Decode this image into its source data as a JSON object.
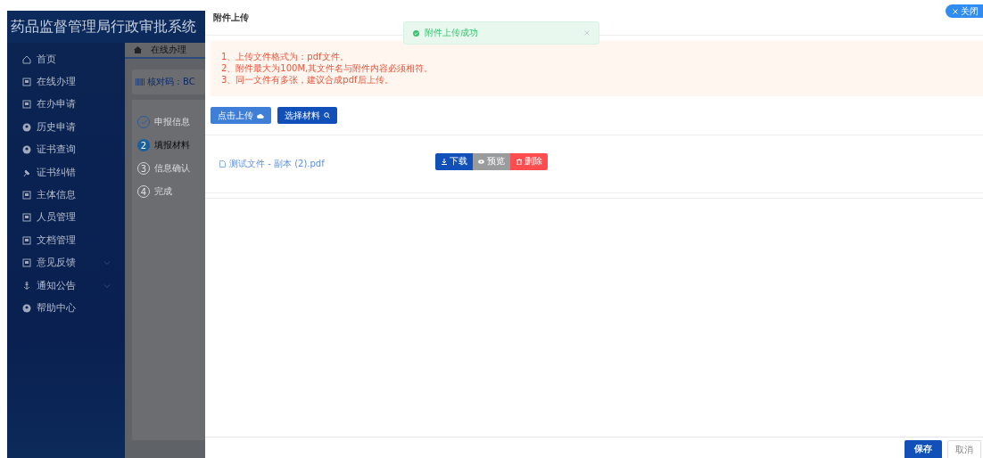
{
  "app": {
    "title": "药品监督管理局行政审批系统"
  },
  "sidebar": {
    "items": [
      {
        "label": "首页",
        "kind": "home",
        "expandable": false
      },
      {
        "label": "在线办理",
        "kind": "doc",
        "expandable": false
      },
      {
        "label": "在办申请",
        "kind": "doc",
        "expandable": false
      },
      {
        "label": "历史申请",
        "kind": "user",
        "expandable": false
      },
      {
        "label": "证书查询",
        "kind": "user",
        "expandable": false
      },
      {
        "label": "证书纠错",
        "kind": "pin",
        "expandable": false
      },
      {
        "label": "主体信息",
        "kind": "doc",
        "expandable": false
      },
      {
        "label": "人员管理",
        "kind": "doc",
        "expandable": false
      },
      {
        "label": "文档管理",
        "kind": "doc",
        "expandable": false
      },
      {
        "label": "意见反馈",
        "kind": "doc",
        "expandable": true
      },
      {
        "label": "通知公告",
        "kind": "anchor",
        "expandable": true
      },
      {
        "label": "帮助中心",
        "kind": "user",
        "expandable": false
      }
    ]
  },
  "breadcrumb": {
    "tab": "在线办理"
  },
  "barcode": {
    "label": "核对码：BC"
  },
  "steps": [
    {
      "label": "申报信息",
      "done": true,
      "selected": false
    },
    {
      "number": "2",
      "label": "填报材料",
      "done": false,
      "selected": true
    },
    {
      "number": "3",
      "label": "信息确认",
      "done": false,
      "selected": false
    },
    {
      "number": "4",
      "label": "完成",
      "done": false,
      "selected": false
    }
  ],
  "drawer": {
    "title": "附件上传",
    "close": "关闭",
    "notes": [
      "1、上传文件格式为：pdf文件。",
      "2、附件最大为100M,其文件名与附件内容必须相符。",
      "3、同一文件有多张，建议合成pdf后上传。"
    ],
    "upload_buttons": [
      {
        "label": "点击上传",
        "kind": "upload"
      },
      {
        "label": "选择材料",
        "kind": "select"
      }
    ],
    "files": [
      {
        "name": "测试文件 - 副本 (2).pdf",
        "actions": [
          {
            "label": "下载",
            "kind": "download"
          },
          {
            "label": "预览",
            "kind": "preview"
          },
          {
            "label": "删除",
            "kind": "delete"
          }
        ]
      }
    ],
    "footer": [
      {
        "label": "保存",
        "kind": "primary"
      },
      {
        "label": "取消",
        "kind": "plain"
      }
    ]
  },
  "toast": {
    "message": "附件上传成功"
  }
}
